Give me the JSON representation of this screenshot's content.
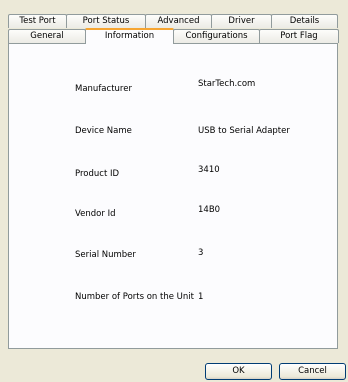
{
  "tabs_back": [
    "Test Port",
    "Port Status",
    "Advanced",
    "Driver",
    "Details"
  ],
  "tabs_front": [
    "General",
    "Information",
    "Configurations",
    "Port Flag"
  ],
  "active_tab": "Information",
  "info": [
    {
      "label": "Manufacturer",
      "value": "StarTech.com"
    },
    {
      "label": "Device Name",
      "value": "USB to Serial Adapter"
    },
    {
      "label": "Product ID",
      "value": "3410"
    },
    {
      "label": "Vendor Id",
      "value": "14B0"
    },
    {
      "label": "Serial Number",
      "value": "3"
    },
    {
      "label": "Number of Ports on the Unit",
      "value": "1"
    }
  ],
  "buttons": {
    "ok": "OK",
    "cancel": "Cancel"
  },
  "colors": {
    "accent": "#f6a532",
    "background": "#ece9d8",
    "panel": "#fcfcfe",
    "border": "#919b9c"
  }
}
